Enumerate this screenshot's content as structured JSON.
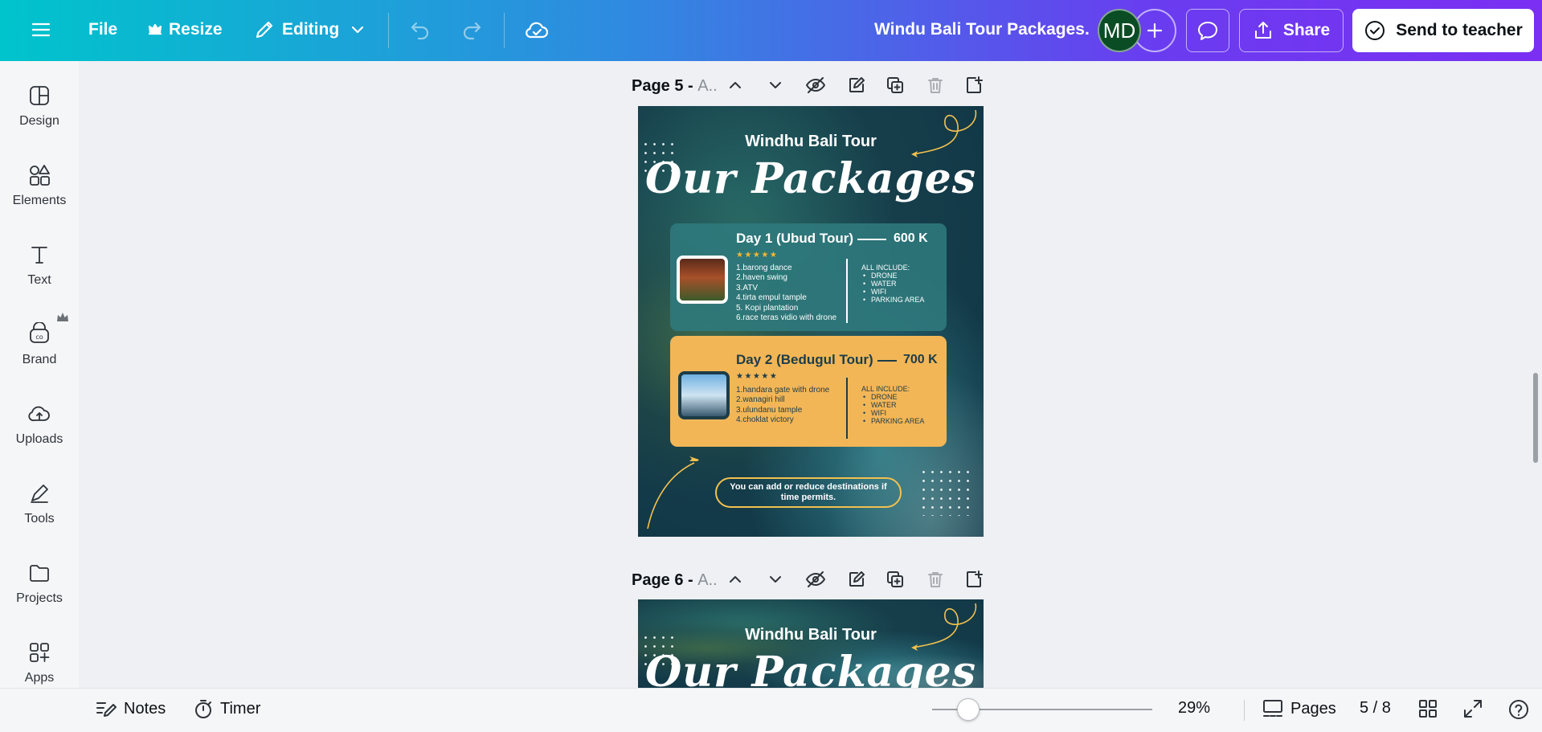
{
  "topbar": {
    "file_label": "File",
    "resize_label": "Resize",
    "editing_label": "Editing",
    "doc_title": "Windu Bali Tour Packages.",
    "avatar_initials": "MD",
    "share_label": "Share",
    "send_label": "Send to teacher"
  },
  "sidebar": {
    "items": [
      {
        "label": "Design",
        "icon": "design-icon"
      },
      {
        "label": "Elements",
        "icon": "elements-icon"
      },
      {
        "label": "Text",
        "icon": "text-icon"
      },
      {
        "label": "Brand",
        "icon": "brand-icon"
      },
      {
        "label": "Uploads",
        "icon": "uploads-icon"
      },
      {
        "label": "Tools",
        "icon": "tools-icon"
      },
      {
        "label": "Projects",
        "icon": "projects-icon"
      },
      {
        "label": "Apps",
        "icon": "apps-icon"
      }
    ]
  },
  "pages": [
    {
      "label": "Page 5 - ",
      "label_muted": "A.."
    },
    {
      "label": "Page 6 - ",
      "label_muted": "A.."
    }
  ],
  "poster": {
    "brand": "Windhu Bali Tour",
    "headline": "Our Packages",
    "stars": "★★★★★",
    "card1": {
      "title": "Day 1 (Ubud Tour)",
      "price": "600 K",
      "items": [
        "1.barong dance",
        "2.haven swing",
        "3.ATV",
        "4.tirta empul tample",
        "5. Kopi plantation",
        "6.race teras vidio with drone"
      ],
      "include_title": "ALL INCLUDE:",
      "includes": [
        "DRONE",
        "WATER",
        "WIFI",
        "PARKING AREA"
      ]
    },
    "card2": {
      "title": "Day 2 (Bedugul Tour)",
      "price": "700 K",
      "items": [
        "1.handara gate with drone",
        "2.wanagiri hill",
        "3.ulundanu tample",
        "4.choklat victory"
      ],
      "include_title": "ALL INCLUDE:",
      "includes": [
        "DRONE",
        "WATER",
        "WIFI",
        "PARKING AREA"
      ]
    },
    "note": "You can add or reduce destinations if time permits."
  },
  "bottombar": {
    "notes_label": "Notes",
    "timer_label": "Timer",
    "zoom_percent": 29,
    "zoom_label": "29%",
    "pages_label": "Pages",
    "page_counter": "5 / 8"
  },
  "colors": {
    "topbar_start": "#00c4cc",
    "topbar_end": "#7b2ff2",
    "card_teal": "#2f7a7d",
    "card_gold": "#f2b657",
    "avatar": "#0a4d24"
  }
}
